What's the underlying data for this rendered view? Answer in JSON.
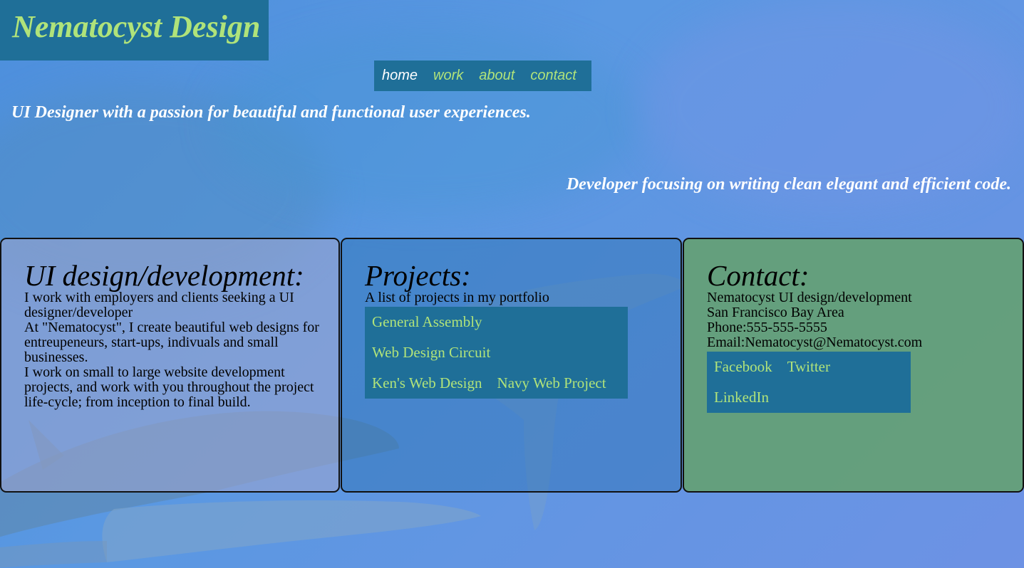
{
  "site_title": "Nematocyst Design",
  "nav": {
    "items": [
      {
        "label": "home",
        "active": true
      },
      {
        "label": "work",
        "active": false
      },
      {
        "label": "about",
        "active": false
      },
      {
        "label": "contact",
        "active": false
      }
    ]
  },
  "taglines": {
    "designer": "UI Designer with a passion for beautiful and functional user experiences.",
    "developer": "Developer focusing on writing clean elegant and efficient code."
  },
  "about_panel": {
    "heading": "UI design/development:",
    "paragraphs": [
      "I work with employers and clients seeking a UI designer/developer",
      "At \"Nematocyst\", I create beautiful web designs for entreupeneurs, start-ups, indivuals and small businesses.",
      "I work on small to large website development projects, and work with you throughout the project life-cycle; from inception to final build."
    ]
  },
  "projects_panel": {
    "heading": "Projects:",
    "intro": "A list of projects in my portfolio",
    "links": [
      "General Assembly",
      "Web Design Circuit",
      "Ken's Web Design",
      "Navy Web Project"
    ]
  },
  "contact_panel": {
    "heading": "Contact:",
    "lines": [
      "Nematocyst UI design/development",
      "San Francisco Bay Area",
      "Phone:555-555-5555",
      "Email:Nematocyst@Nematocyst.com"
    ],
    "social_links": [
      "Facebook",
      "Twitter",
      "LinkedIn"
    ]
  },
  "colors": {
    "title_bar": "#1f6f98",
    "link_green": "#b0e37a",
    "background_blue": "#5a98e2",
    "contact_panel_green": "#64a06e"
  }
}
